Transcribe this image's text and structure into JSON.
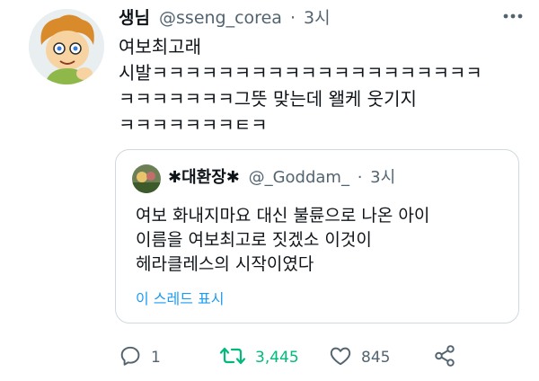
{
  "tweet": {
    "name": "생님",
    "handle": "@sseng_corea",
    "dot": "·",
    "time": "3시",
    "text": "여보최고래\n시발ㅋㅋㅋㅋㅋㅋㅋㅋㅋㅋㅋㅋㅋㅋㅋㅋㅋㅋㅋㅋ\nㅋㅋㅋㅋㅋㅋㅋ그뜻 맞는데 왤케 웃기지\nㅋㅋㅋㅋㅋㅋㅋㅌㅋ"
  },
  "quote": {
    "name": "✱대환장✱",
    "handle": "@_Goddam_",
    "dot": "·",
    "time": "3시",
    "text": "여보 화내지마요 대신 불륜으로 나온 아이\n이름을 여보최고로 짓겠소 이것이\n헤라클레스의 시작이였다",
    "thread_link": "이 스레드 표시"
  },
  "actions": {
    "reply": "1",
    "retweet": "3,445",
    "like": "845"
  },
  "colors": {
    "accent": "#1d9bf0",
    "retweet": "#00ba7c",
    "muted": "#536471"
  },
  "icons": [
    "more-icon",
    "reply-icon",
    "retweet-icon",
    "like-icon",
    "share-icon"
  ]
}
